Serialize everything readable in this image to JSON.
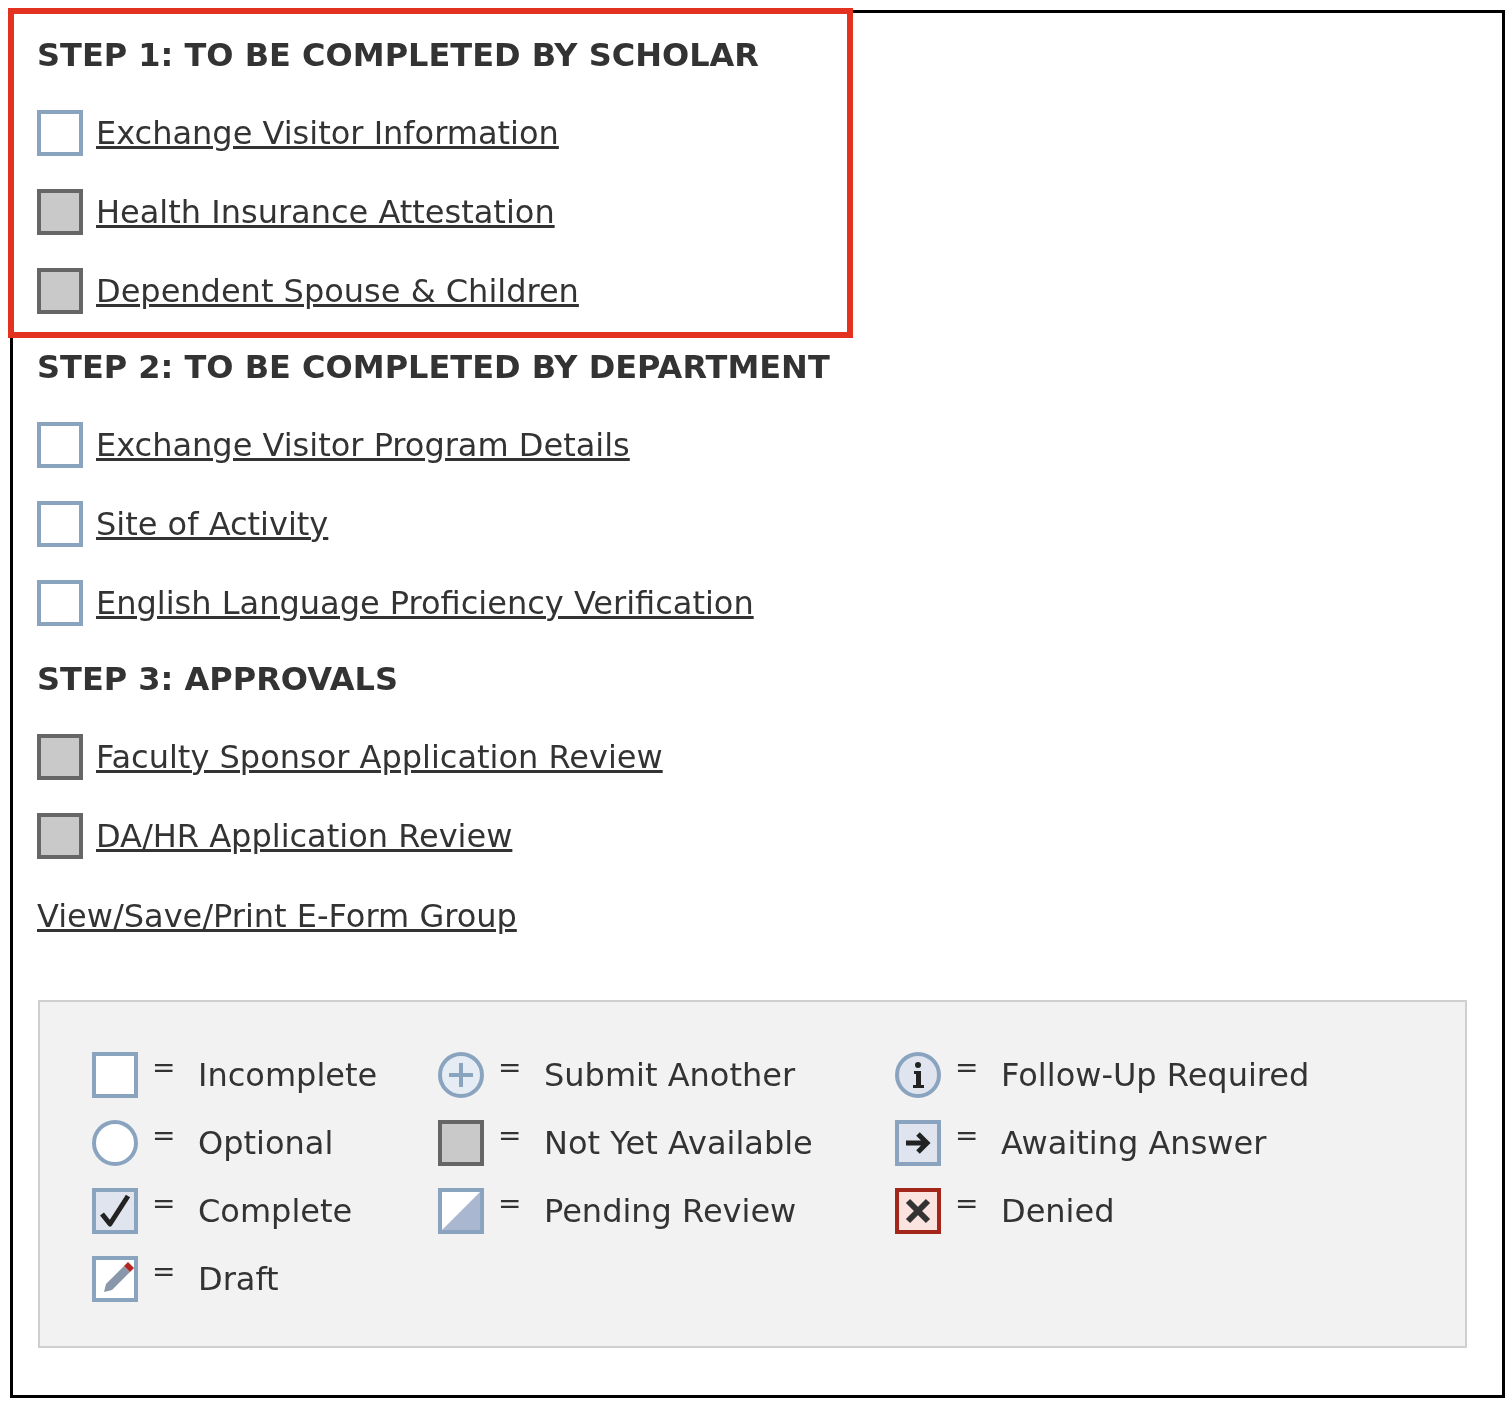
{
  "steps": [
    {
      "heading": "STEP 1: TO BE COMPLETED BY SCHOLAR",
      "highlighted": true,
      "items": [
        {
          "label": "Exchange Visitor Information",
          "kind": "incomplete"
        },
        {
          "label": "Health Insurance Attestation",
          "kind": "not_available"
        },
        {
          "label": "Dependent Spouse & Children",
          "kind": "not_available"
        }
      ]
    },
    {
      "heading": "STEP 2: TO BE COMPLETED BY DEPARTMENT",
      "highlighted": false,
      "items": [
        {
          "label": "Exchange Visitor Program Details",
          "kind": "incomplete"
        },
        {
          "label": "Site of Activity",
          "kind": "incomplete"
        },
        {
          "label": "English Language Proficiency Verification",
          "kind": "incomplete"
        }
      ]
    },
    {
      "heading": "STEP 3: APPROVALS",
      "highlighted": false,
      "items": [
        {
          "label": "Faculty Sponsor Application Review",
          "kind": "not_available"
        },
        {
          "label": "DA/HR Application Review",
          "kind": "not_available"
        }
      ]
    }
  ],
  "group_link": "View/Save/Print E-Form Group",
  "legend": {
    "columns": [
      [
        {
          "kind": "incomplete",
          "equals": "=",
          "label": "Incomplete"
        },
        {
          "kind": "optional",
          "equals": "=",
          "label": "Optional"
        },
        {
          "kind": "complete",
          "equals": "=",
          "label": "Complete"
        },
        {
          "kind": "draft",
          "equals": "=",
          "label": "Draft"
        }
      ],
      [
        {
          "kind": "submit_another",
          "equals": "=",
          "label": "Submit Another"
        },
        {
          "kind": "not_available",
          "equals": "=",
          "label": "Not Yet Available"
        },
        {
          "kind": "pending_review",
          "equals": "=",
          "label": "Pending Review"
        }
      ],
      [
        {
          "kind": "follow_up",
          "equals": "=",
          "label": "Follow-Up Required"
        },
        {
          "kind": "awaiting",
          "equals": "=",
          "label": "Awaiting Answer"
        },
        {
          "kind": "denied",
          "equals": "=",
          "label": "Denied"
        }
      ]
    ]
  }
}
